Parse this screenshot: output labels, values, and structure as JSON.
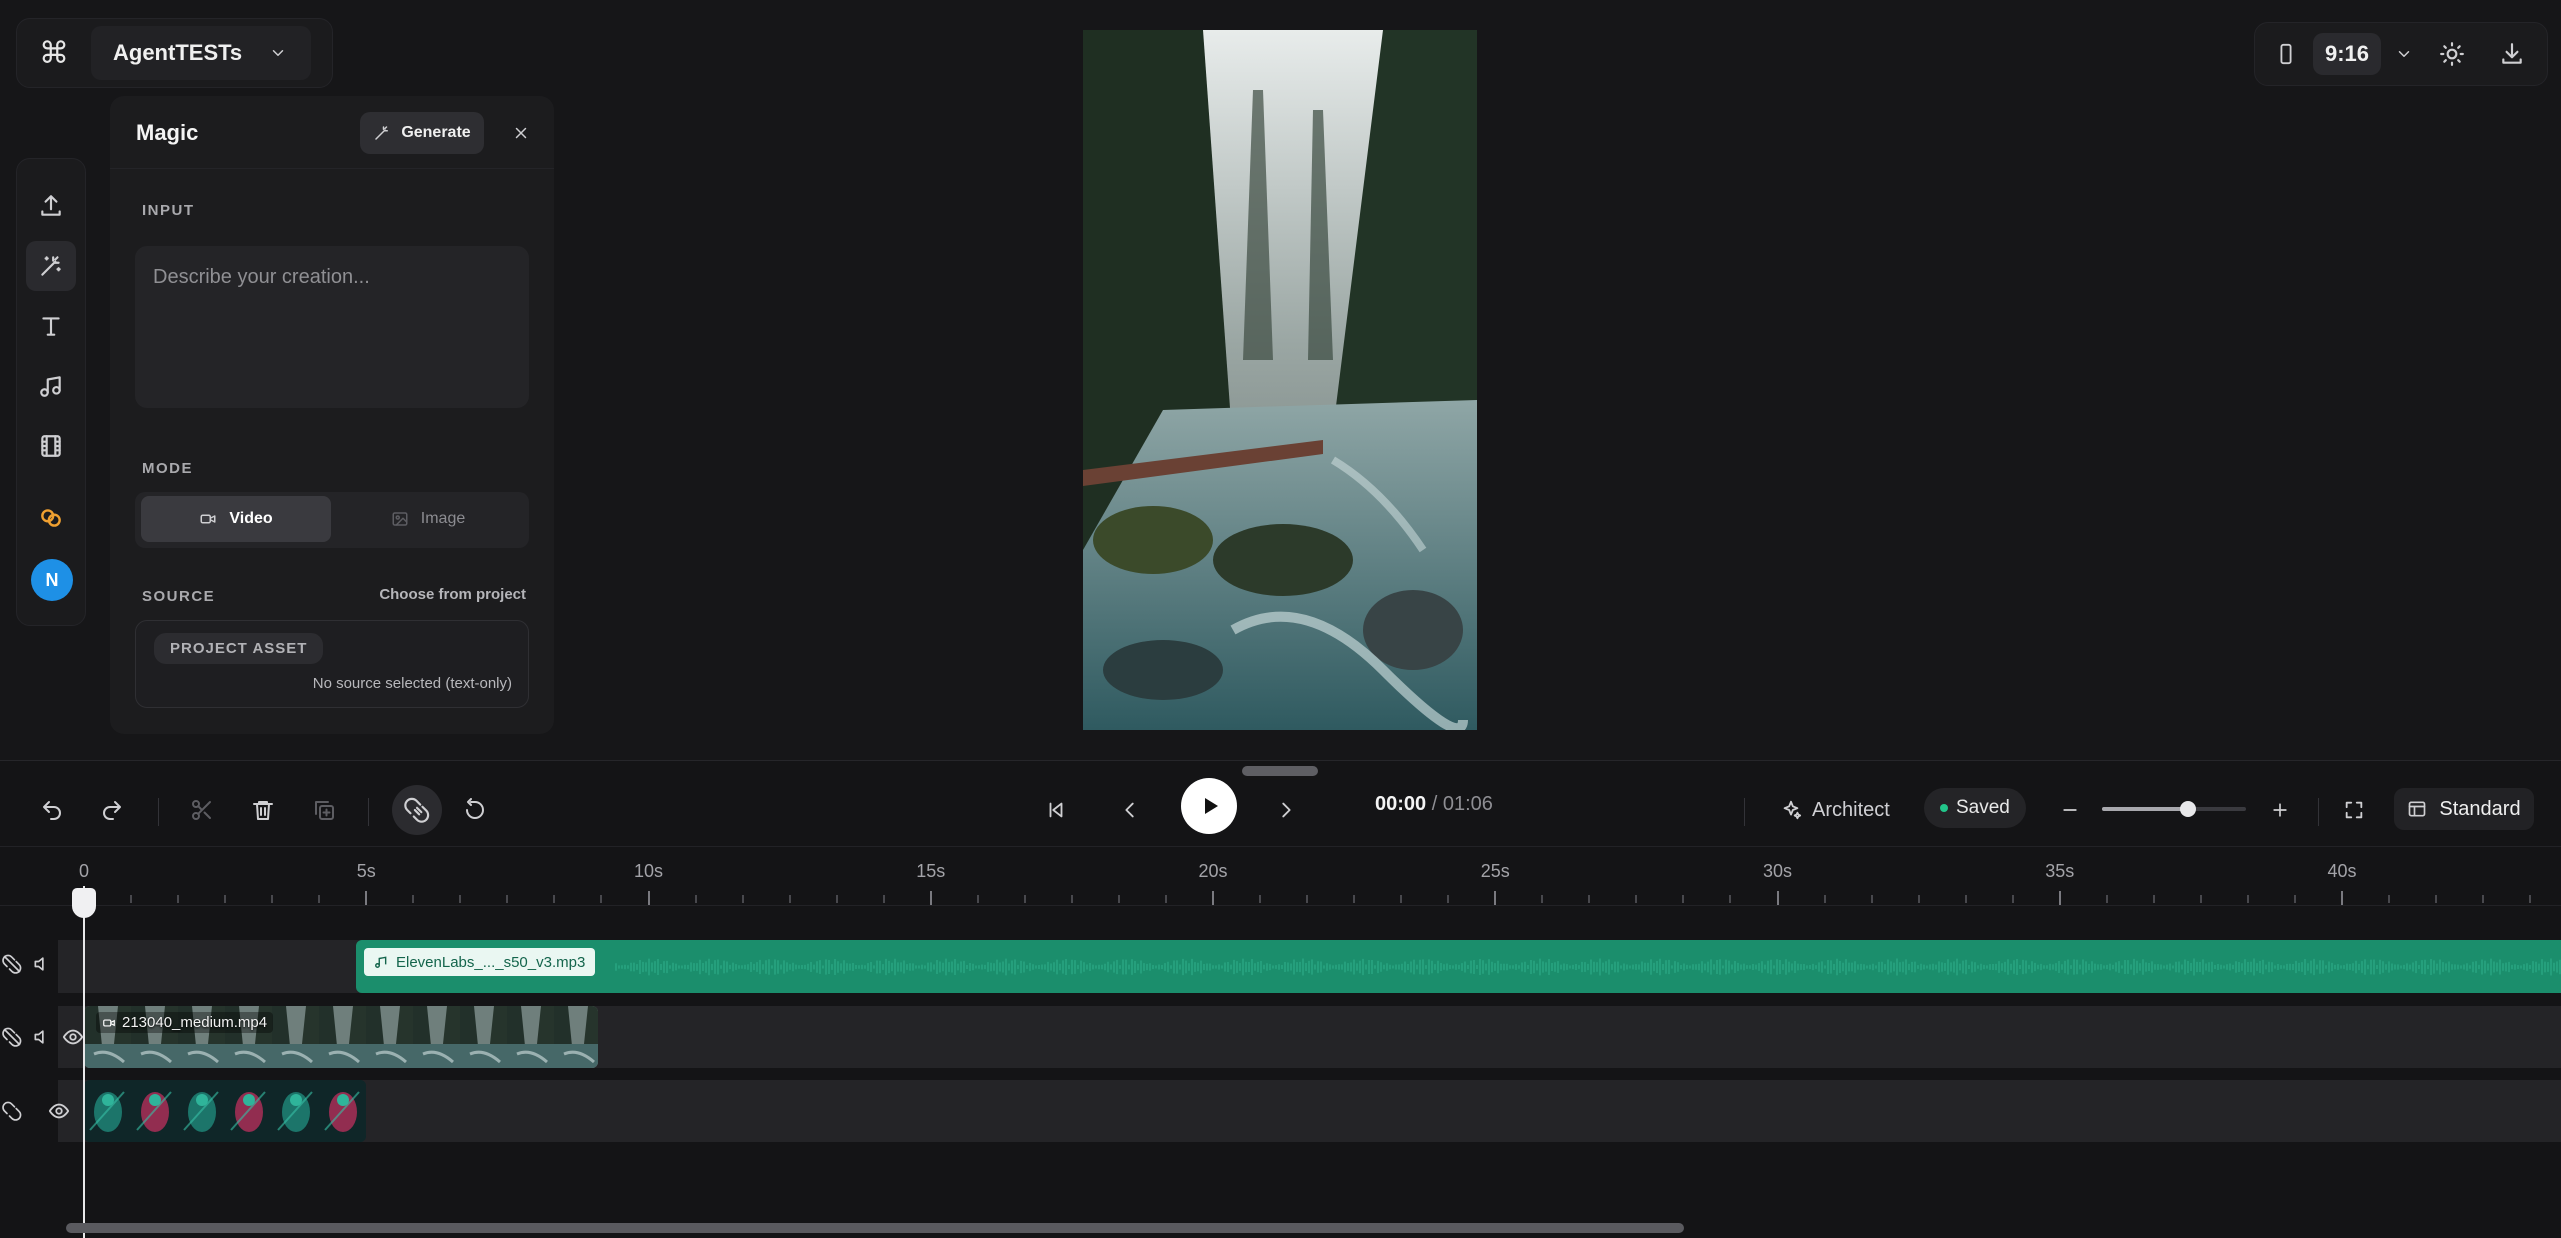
{
  "header": {
    "project_name": "AgentTESTs",
    "aspect_ratio": "9:16"
  },
  "icons": {
    "command": "command-icon",
    "upload": "upload-icon",
    "magic": "magic-wand-icon",
    "text": "text-icon",
    "music": "music-note-icon",
    "film": "film-icon",
    "link": "link-icon",
    "phone": "phone-icon",
    "sun": "sun-icon",
    "download": "download-icon"
  },
  "user": {
    "avatar_initial": "N"
  },
  "magic_panel": {
    "title": "Magic",
    "generate_label": "Generate",
    "input_label": "INPUT",
    "prompt_placeholder": "Describe your creation...",
    "mode_label": "MODE",
    "mode_video": "Video",
    "mode_image": "Image",
    "mode_selected": "Video",
    "source_label": "SOURCE",
    "choose_from_project": "Choose from project",
    "project_asset_badge": "PROJECT ASSET",
    "no_source_text": "No source selected (text-only)"
  },
  "player": {
    "current_time": "00:00",
    "separator": "/",
    "total_time": "01:06",
    "architect_label": "Architect",
    "saved_label": "Saved",
    "zoom_level": 0.6,
    "view_mode": "Standard"
  },
  "ruler": {
    "labels": [
      "0",
      "5s",
      "10s",
      "15s",
      "20s",
      "25s",
      "30s",
      "35s",
      "40s"
    ]
  },
  "tracks": {
    "audio_clip": "ElevenLabs_..._s50_v3.mp3",
    "video_clip": "213040_medium.mp4"
  },
  "colors": {
    "audio_clip": "#1b8e6c",
    "saved_dot": "#22c58a",
    "avatar": "#1e90e6",
    "link_icon": "#f0a030"
  }
}
